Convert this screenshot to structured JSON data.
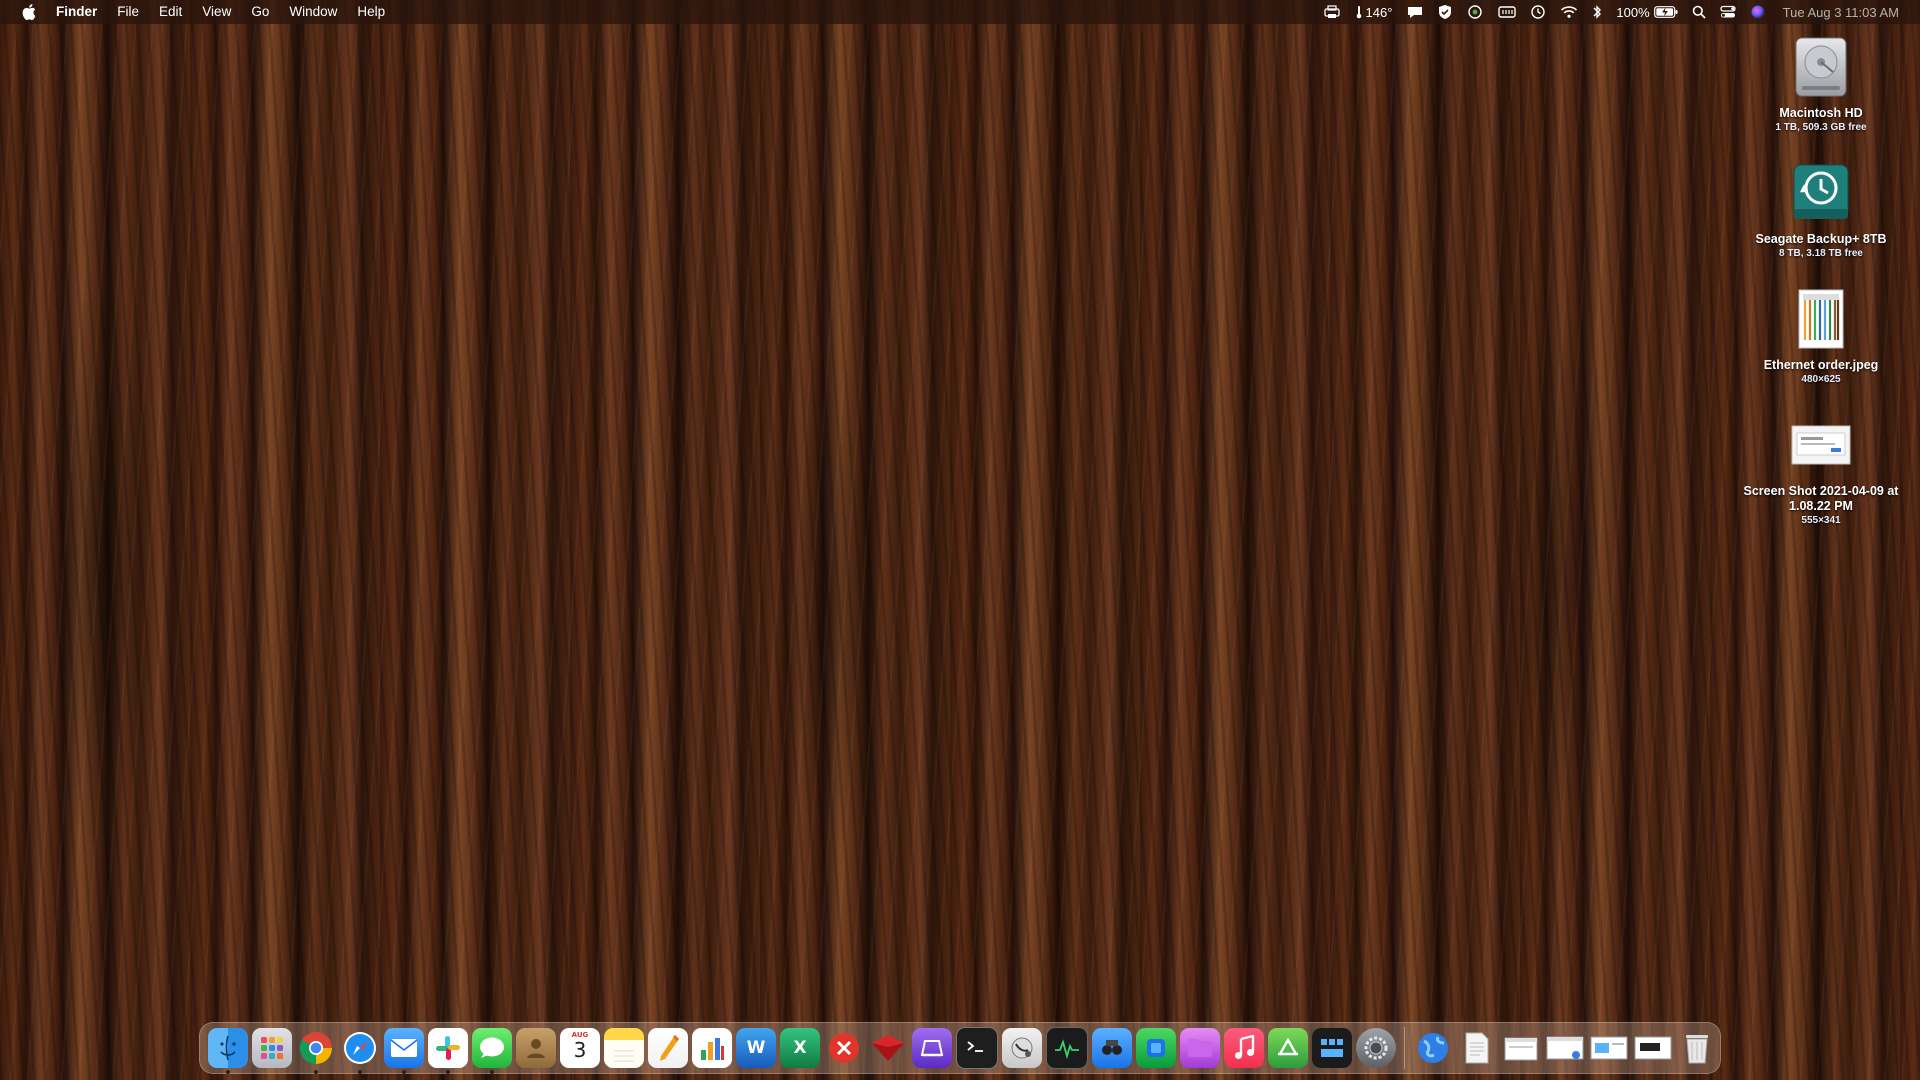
{
  "menubar": {
    "app_name": "Finder",
    "menus": [
      "File",
      "Edit",
      "View",
      "Go",
      "Window",
      "Help"
    ],
    "temperature": "146°",
    "battery_percent": "100%",
    "clock": "Tue Aug 3  11:03 AM"
  },
  "desktop_icons": [
    {
      "name": "Macintosh HD",
      "info": "1 TB, 509.3 GB free",
      "icon": "hard-drive-icon"
    },
    {
      "name": "Seagate Backup+ 8TB",
      "info": "8 TB, 3.18 TB free",
      "icon": "time-machine-drive-icon"
    },
    {
      "name": "Ethernet order.jpeg",
      "info": "480×625",
      "icon": "image-file-icon"
    },
    {
      "name": "Screen Shot 2021-04-09 at 1.08.22 PM",
      "info": "555×341",
      "icon": "screenshot-file-icon"
    }
  ],
  "dock": {
    "calendar_month": "AUG",
    "calendar_day": "3",
    "word_letter": "W",
    "excel_letter": "X",
    "apps": [
      "finder-icon",
      "launchpad-icon",
      "chrome-icon",
      "safari-icon",
      "mail-icon",
      "slack-icon",
      "messages-icon",
      "contacts-icon",
      "calendar-icon",
      "notes-icon",
      "pages-icon",
      "numbers-icon",
      "word-icon",
      "excel-icon",
      "remote-desktop-icon",
      "unknown-red-icon",
      "database-icon",
      "terminal-icon",
      "disk-utility-icon",
      "activity-monitor-icon",
      "directory-utility-icon",
      "screen-time-icon",
      "app-folder-icon",
      "music-icon",
      "app-store-icon",
      "mission-control-icon",
      "system-preferences-icon",
      "network-globe-icon",
      "document-icon",
      "window-stack-icon-1",
      "window-stack-icon-2",
      "window-stack-icon-3",
      "window-stack-icon-4",
      "trash-icon"
    ]
  }
}
